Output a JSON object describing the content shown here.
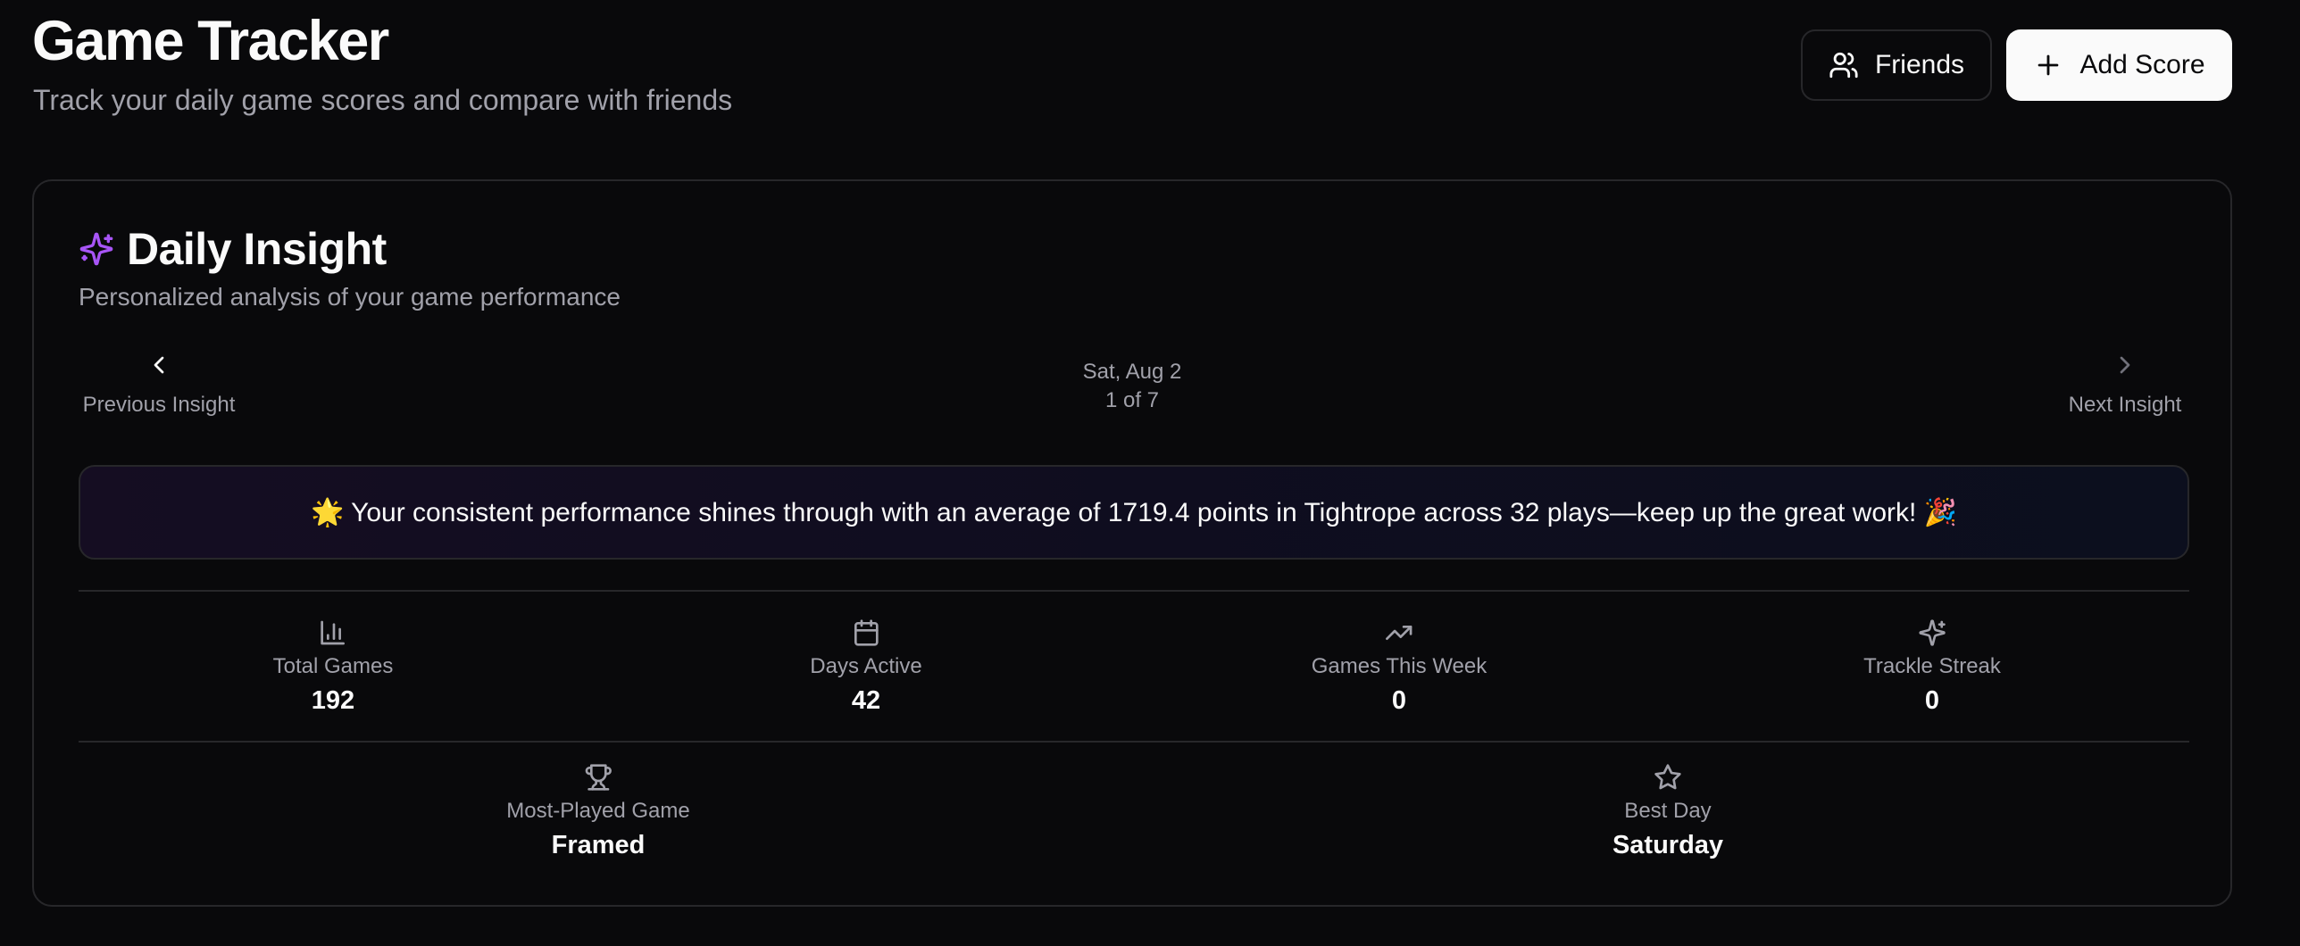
{
  "header": {
    "title": "Game Tracker",
    "subtitle": "Track your daily game scores and compare with friends",
    "friends_label": "Friends",
    "add_score_label": "Add Score"
  },
  "insight_card": {
    "title": "Daily Insight",
    "description": "Personalized analysis of your game performance",
    "prev_label": "Previous Insight",
    "next_label": "Next Insight",
    "date": "Sat, Aug 2",
    "position": "1 of 7",
    "message": "🌟 Your consistent performance shines through with an average of 1719.4 points in Tightrope across 32 plays—keep up the great work! 🎉",
    "accent_color": "#a855f7"
  },
  "stats": [
    {
      "icon": "bar-chart-icon",
      "label": "Total Games",
      "value": "192"
    },
    {
      "icon": "calendar-icon",
      "label": "Days Active",
      "value": "42"
    },
    {
      "icon": "trending-up-icon",
      "label": "Games This Week",
      "value": "0"
    },
    {
      "icon": "sparkles-icon",
      "label": "Trackle Streak",
      "value": "0"
    }
  ],
  "highlights": [
    {
      "icon": "trophy-icon",
      "label": "Most-Played Game",
      "value": "Framed"
    },
    {
      "icon": "star-icon",
      "label": "Best Day",
      "value": "Saturday"
    }
  ]
}
